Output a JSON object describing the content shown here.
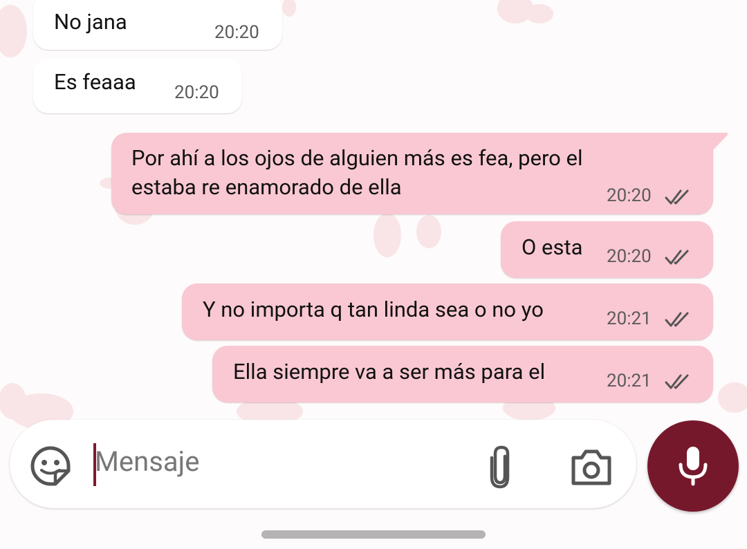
{
  "theme": {
    "incoming_bubble": "#ffffff",
    "outgoing_bubble": "#f9c8d3",
    "accent": "#76182c",
    "tick_color": "#555555"
  },
  "messages": [
    {
      "direction": "incoming",
      "text": "No jana",
      "time": "20:20"
    },
    {
      "direction": "incoming",
      "text": "Es feaaa",
      "time": "20:20"
    },
    {
      "direction": "outgoing",
      "lines": [
        "Por ahí a los ojos de alguien más es fea, pero el",
        "estaba re enamorado de ella"
      ],
      "time": "20:20",
      "status": "read-double-check-icon"
    },
    {
      "direction": "outgoing",
      "text": "O esta",
      "time": "20:20",
      "status": "read-double-check-icon"
    },
    {
      "direction": "outgoing",
      "text": "Y no importa q tan linda sea o no yo",
      "time": "20:21",
      "status": "read-double-check-icon"
    },
    {
      "direction": "outgoing",
      "text": "Ella siempre va a ser más para el",
      "time": "20:21",
      "status": "read-double-check-icon"
    }
  ],
  "composer": {
    "placeholder": "Mensaje",
    "value": "",
    "icons": [
      "sticker-icon",
      "attach-icon",
      "camera-icon",
      "mic-icon"
    ]
  }
}
